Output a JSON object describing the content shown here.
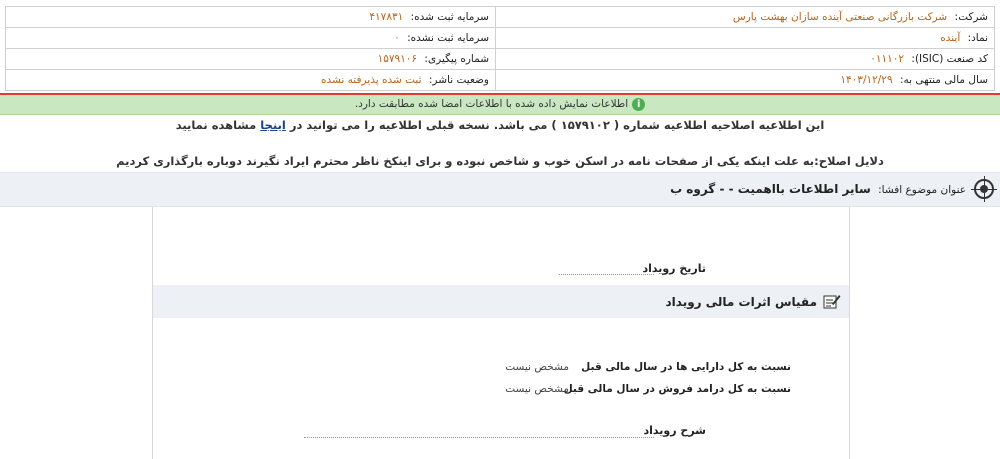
{
  "company": {
    "company_label": "شرکت:",
    "company_value": "شرکت بازرگانی صنعتی آینده سازان بهشت پارس",
    "symbol_label": "نماد:",
    "symbol_value": "آینده",
    "isic_label": "کد صنعت (ISIC):",
    "isic_value": "۰۱۱۱۰۲",
    "fiscal_label": "سال مالی منتهی به:",
    "fiscal_value": "۱۴۰۳/۱۲/۲۹",
    "reg_capital_label": "سرمایه ثبت شده:",
    "reg_capital_value": "۴۱۷۸۳۱",
    "unreg_capital_label": "سرمایه ثبت نشده:",
    "unreg_capital_value": "۰",
    "tracking_label": "شماره پیگیری:",
    "tracking_value": "۱۵۷۹۱۰۶",
    "status_label": "وضعیت ناشر:",
    "status_value": "ثبت شده پذیرفته نشده"
  },
  "verified_message": "اطلاعات نمایش داده شده با اطلاعات امضا شده مطابقت دارد.",
  "notice": {
    "text_before": "این اطلاعیه اصلاحیه اطلاعیه شماره ( ۱۵۷۹۱۰۲ ) می باشد. نسخه قبلی اطلاعیه را می توانید در",
    "link": "اینجا",
    "text_after": "مشاهده نمایید"
  },
  "correction_reason": "دلایل اصلاح:به علت اینکه یکی از صفحات نامه در اسکن خوب و شاخص نبوده و برای اینکخ ناظر محترم ایراد نگیرند دوباره بارگذاری کردیم",
  "subject": {
    "label": "عنوان موضوع افشا:",
    "value": "سایر اطلاعات بااهمیت - - گروه ب"
  },
  "event_date_label": "تاریخ رویداد",
  "financial_effects_title": "مقیاس اثرات مالی رویداد",
  "effects": [
    {
      "label": "نسبت به کل دارایی ها در سال مالی قبل",
      "value": "مشخص نیست"
    },
    {
      "label": "نسبت به کل درامد فروش در سال مالی قبل",
      "value": "مشخص نیست"
    }
  ],
  "event_description_label": "شرح رویداد"
}
